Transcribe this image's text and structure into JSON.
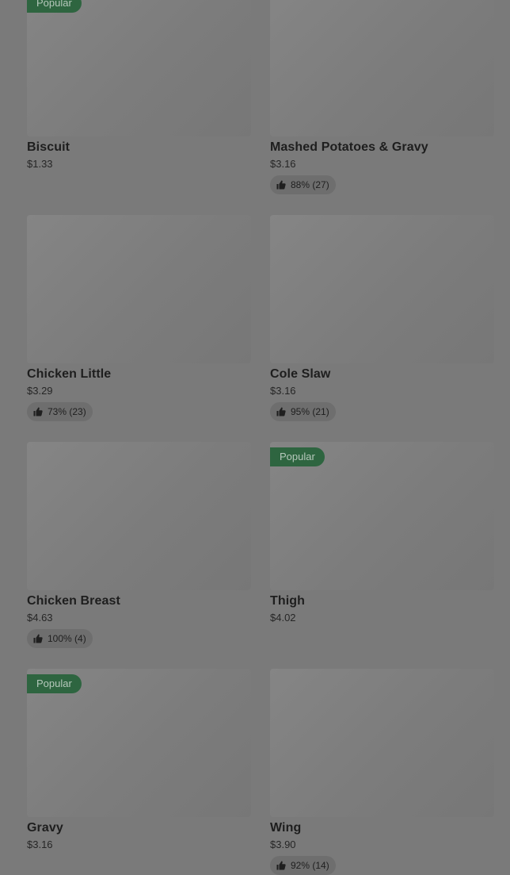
{
  "colors": {
    "overlay_bg": "#7a7a7a",
    "badge_bg": "#2e6540",
    "badge_text": "#b6c8bb",
    "rating_bg": "#6e6e6e"
  },
  "items": [
    {
      "name": "Biscuit",
      "price": "$1.33",
      "badge": "Popular",
      "rating": ""
    },
    {
      "name": "Mashed Potatoes & Gravy",
      "price": "$3.16",
      "badge": "",
      "rating": "88% (27)"
    },
    {
      "name": "Chicken Little",
      "price": "$3.29",
      "badge": "",
      "rating": "73% (23)"
    },
    {
      "name": "Cole Slaw",
      "price": "$3.16",
      "badge": "",
      "rating": "95% (21)"
    },
    {
      "name": "Chicken Breast",
      "price": "$4.63",
      "badge": "",
      "rating": "100% (4)"
    },
    {
      "name": "Thigh",
      "price": "$4.02",
      "badge": "Popular",
      "rating": ""
    },
    {
      "name": "Gravy",
      "price": "$3.16",
      "badge": "Popular",
      "rating": ""
    },
    {
      "name": "Wing",
      "price": "$3.90",
      "badge": "",
      "rating": "92% (14)"
    }
  ]
}
